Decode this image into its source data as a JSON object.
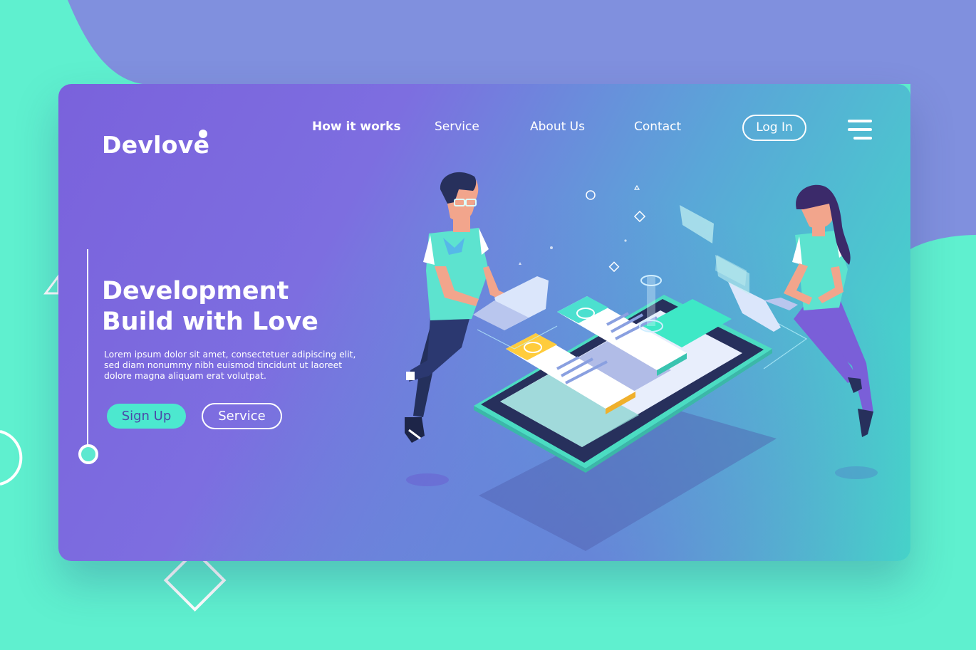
{
  "brand": {
    "name": "Devlove"
  },
  "nav": {
    "items": [
      {
        "label": "How it works"
      },
      {
        "label": "Service"
      },
      {
        "label": "About Us"
      },
      {
        "label": "Contact"
      }
    ],
    "login_label": "Log In"
  },
  "hero": {
    "headline_line1": "Development",
    "headline_line2": "Build with Love",
    "body_line1": "Lorem ipsum dolor sit amet, consectetuer adipiscing elit,",
    "body_line2": "sed diam nonummy nibh euismod tincidunt ut laoreet",
    "body_line3": "dolore magna aliquam erat volutpat.",
    "primary_cta": "Sign Up",
    "secondary_cta": "Service"
  },
  "colors": {
    "accent": "#4ce8cf",
    "purple": "#7a62dc",
    "page_bg": "#5ff0cf",
    "blob": "#8090e0"
  },
  "icons": [
    "menu-icon",
    "logo-dot-icon",
    "slider-knob-icon"
  ]
}
